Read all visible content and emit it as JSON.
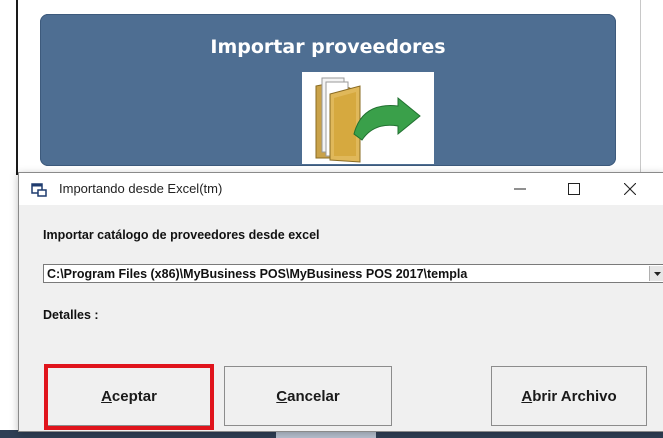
{
  "background_app": {
    "tile_label": "Importar proveedores",
    "tile_icon": "folder-import-icon"
  },
  "dialog": {
    "title": "Importando desde Excel(tm)",
    "title_icon": "app-window-icon",
    "window_controls": {
      "minimize": "minimize-icon",
      "maximize": "maximize-icon",
      "close": "close-icon"
    },
    "caption": "Importar catálogo de proveedores desde excel",
    "file_path": "C:\\Program Files (x86)\\MyBusiness POS\\MyBusiness POS 2017\\templa",
    "details_label": "Detalles :",
    "buttons": {
      "accept": {
        "mnemonic": "A",
        "rest": "ceptar"
      },
      "cancel": {
        "mnemonic": "C",
        "rest": "ancelar"
      },
      "open_file": {
        "mnemonic": "A",
        "rest": "brir Archivo"
      }
    }
  },
  "colors": {
    "tile": "#4e6e92",
    "highlight": "#e0141c",
    "dialog_bg": "#f0f0f0"
  }
}
